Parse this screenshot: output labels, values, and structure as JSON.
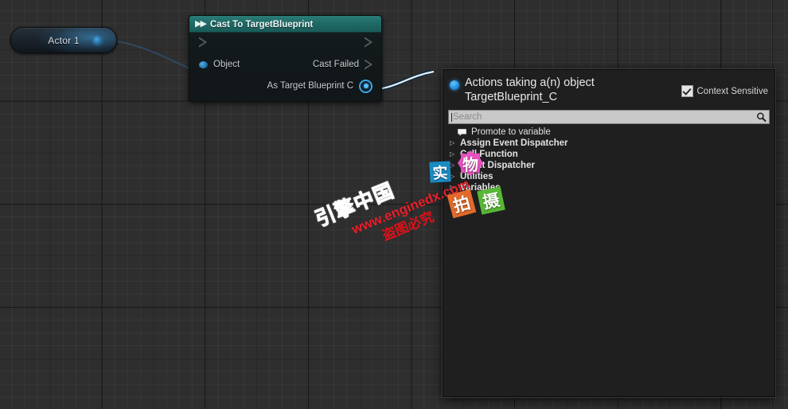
{
  "canvas": {
    "background_color": "#2e2e2e",
    "grid": "blueprint-grid"
  },
  "actor_node": {
    "label": "Actor 1",
    "pin_icon": "object-pin-icon"
  },
  "cast_node": {
    "header_icon": "double-arrow-icon",
    "title": "Cast To TargetBlueprint",
    "header_color": "#1f6a66",
    "pins": {
      "exec_in": "exec-in-pin",
      "exec_out": "exec-out-pin",
      "object_label": "Object",
      "cast_failed_label": "Cast Failed",
      "as_target_label": "As Target Blueprint C"
    }
  },
  "context_menu": {
    "title": "Actions taking a(n) object TargetBlueprint_C",
    "title_line1": "Actions taking a(n) object",
    "title_line2": "TargetBlueprint_C",
    "context_sensitive": {
      "label": "Context Sensitive",
      "checked": true
    },
    "search": {
      "value": "",
      "placeholder": "Search",
      "icon": "search-icon"
    },
    "items": [
      {
        "label": "Promote to variable",
        "type": "action",
        "icon": "promote-variable-icon",
        "expandable": false,
        "bold": false
      },
      {
        "label": "Assign Event Dispatcher",
        "type": "category",
        "expandable": true,
        "bold": true
      },
      {
        "label": "Call Function",
        "type": "category",
        "expandable": true,
        "bold": true
      },
      {
        "label": "Event Dispatcher",
        "type": "category",
        "expandable": true,
        "bold": true
      },
      {
        "label": "Utilities",
        "type": "category",
        "expandable": true,
        "bold": true
      },
      {
        "label": "Variables",
        "type": "category",
        "expandable": true,
        "bold": true
      }
    ]
  },
  "watermarks": {
    "brand": "引擎中国",
    "url": "www.enginedx.com",
    "warning": "盗图必究",
    "tiles": [
      {
        "char": "实",
        "color": "#1a8bc4"
      },
      {
        "char": "物",
        "color": "#e94fc0"
      },
      {
        "char": "拍",
        "color": "#e36a2a"
      },
      {
        "char": "摄",
        "color": "#57b836"
      }
    ]
  }
}
